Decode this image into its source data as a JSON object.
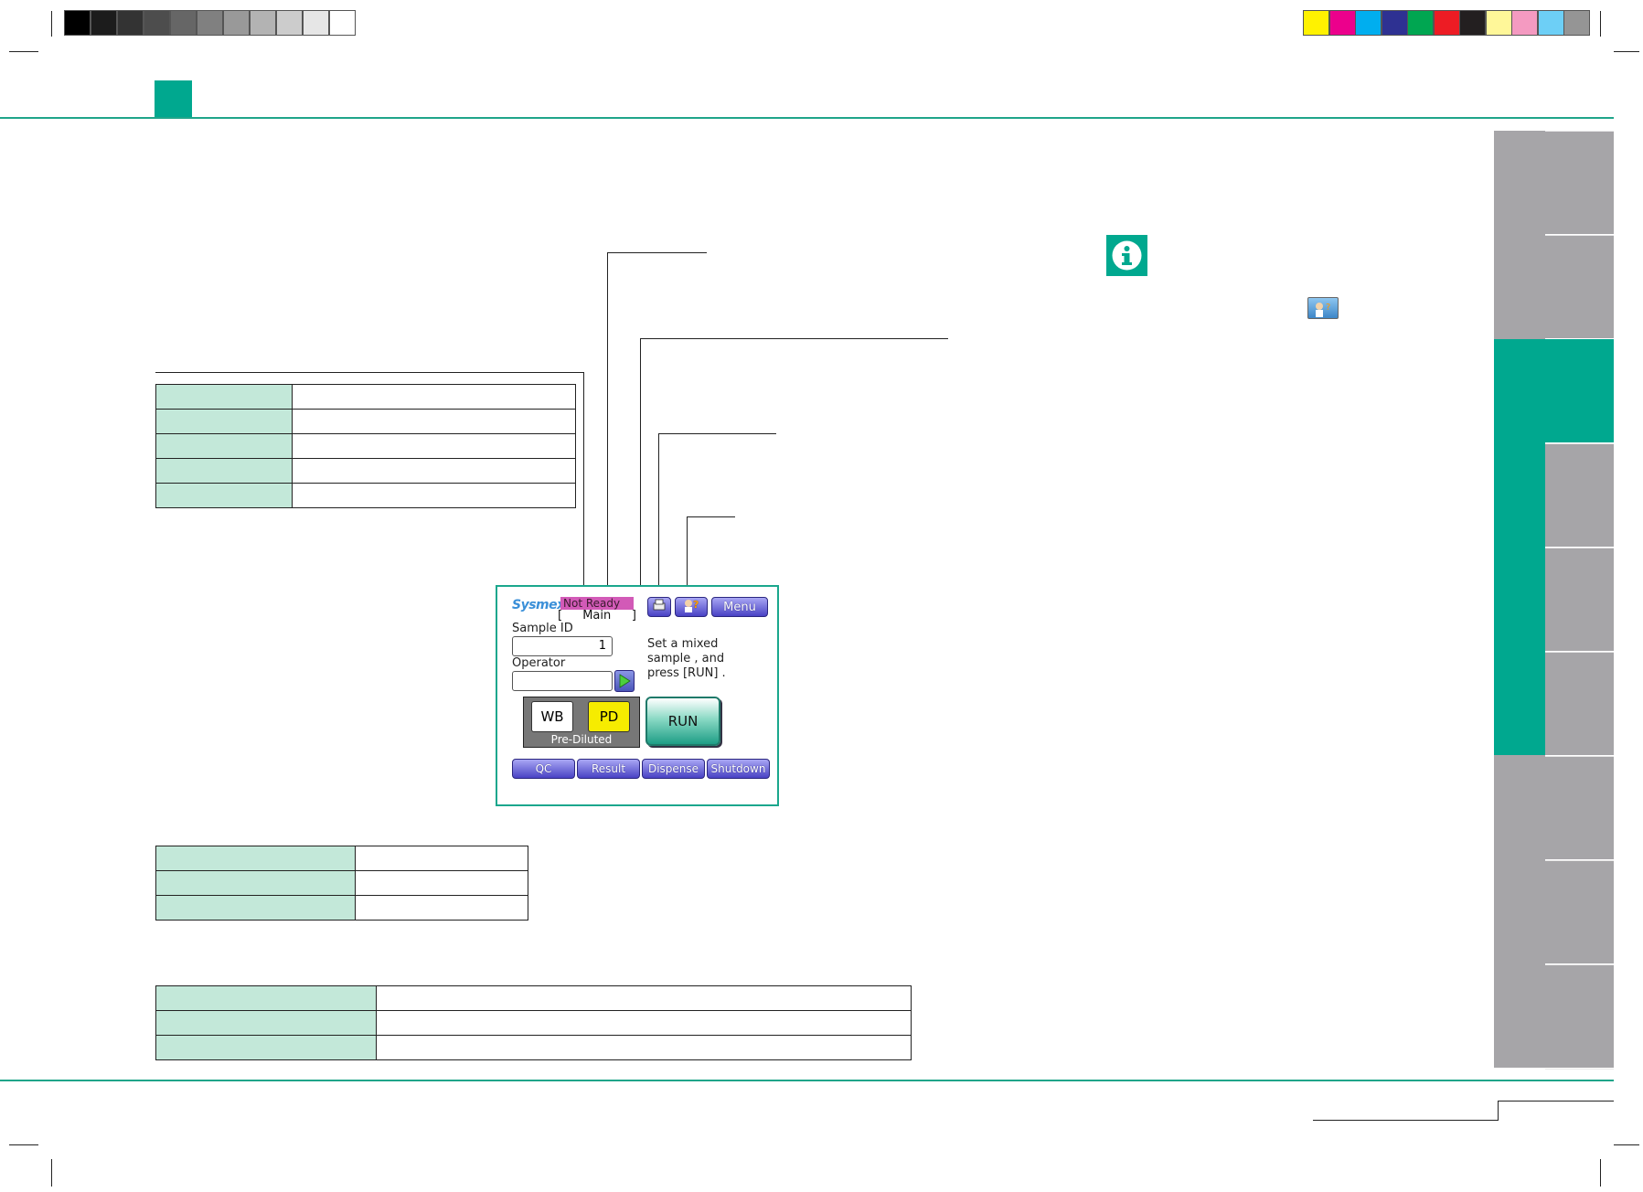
{
  "colors": {
    "accent": "#00a88f",
    "table_label_fill": "#c3e8d9",
    "tab_gray": "#a6a5a8",
    "grayscale_swatches": [
      "#000000",
      "#1c1c1c",
      "#333333",
      "#4d4d4d",
      "#666666",
      "#808080",
      "#999999",
      "#b3b3b3",
      "#cccccc",
      "#e6e6e6",
      "#ffffff"
    ],
    "color_swatches": [
      "#fff200",
      "#ec008c",
      "#00aeef",
      "#2e3192",
      "#00a651",
      "#ed1c24",
      "#231f20",
      "#fff799",
      "#f49ac1",
      "#6dcff6",
      "#959595"
    ]
  },
  "icons": {
    "note": "info-icon",
    "header_thumbnail": "help-thumbnail-icon"
  },
  "screen": {
    "logo": "Sysmex",
    "status": "Not Ready",
    "mode_bracket_left": "[",
    "mode": "Main",
    "mode_bracket_right": "]",
    "menu_button": "Menu",
    "sample_id_label": "Sample ID",
    "sample_id_value": "1",
    "operator_label": "Operator",
    "operator_value": "",
    "instruction_line1": "Set a mixed",
    "instruction_line2": "sample , and",
    "instruction_line3": "press [RUN] .",
    "mode_wb": "WB",
    "mode_pd": "PD",
    "mode_caption": "Pre-Diluted",
    "run_button": "RUN",
    "bottom_buttons": [
      "QC",
      "Result",
      "Dispense",
      "Shutdown"
    ],
    "icon_names": [
      "printer-icon",
      "help-icon",
      "go-arrow-icon"
    ]
  }
}
